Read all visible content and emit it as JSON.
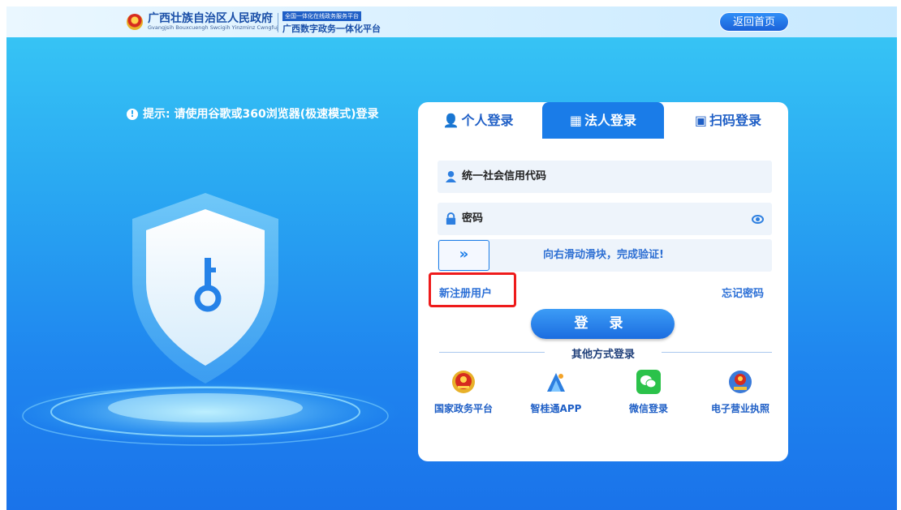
{
  "header": {
    "gov_name": "广西壮族自治区人民政府",
    "gov_name_en": "Gvangjsih Bouxcuengh Swcigih Yinzminz Cwngfuj",
    "platform_badge": "全国一体化在线政务服务平台",
    "platform_name": "广西数字政务一体化平台",
    "home_button": "返回首页"
  },
  "tip": {
    "text": "提示: 请使用谷歌或360浏览器(极速模式)登录"
  },
  "tabs": [
    {
      "label": "个人登录",
      "icon": "person-icon",
      "active": false
    },
    {
      "label": "法人登录",
      "icon": "building-icon",
      "active": true
    },
    {
      "label": "扫码登录",
      "icon": "qr-code-icon",
      "active": false
    }
  ],
  "form": {
    "credit_code_label": "统一社会信用代码",
    "password_label": "密码",
    "slider_arrow": "»",
    "slider_text": "向右滑动滑块，完成验证!",
    "register_link": "新注册用户",
    "forgot_link": "忘记密码",
    "login_button": "登 录"
  },
  "other_login": {
    "title": "其他方式登录",
    "options": [
      {
        "label": "国家政务平台",
        "icon": "national-emblem-icon"
      },
      {
        "label": "智桂通APP",
        "icon": "zhiguitong-app-icon"
      },
      {
        "label": "微信登录",
        "icon": "wechat-icon"
      },
      {
        "label": "电子营业执照",
        "icon": "business-license-icon"
      }
    ]
  },
  "colors": {
    "accent": "#1a7ce8",
    "highlight_box": "#ee1b1b",
    "link": "#2b6fd6"
  }
}
